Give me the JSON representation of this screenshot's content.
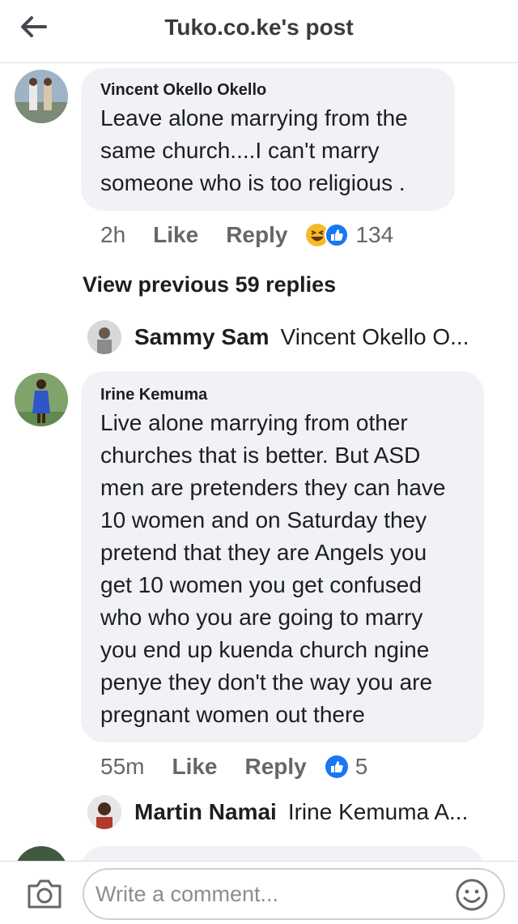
{
  "header": {
    "title": "Tuko.co.ke's post",
    "back_icon": "arrow-left-icon"
  },
  "comments": [
    {
      "author": "Vincent Okello Okello",
      "lines": [
        "Leave alone marrying from  the",
        "same church....I can't marry",
        "someone who is too religious ."
      ],
      "time": "2h",
      "like_label": "Like",
      "reply_label": "Reply",
      "reactions": [
        "haha-icon",
        "like-icon"
      ],
      "reaction_count": "134"
    },
    {
      "author": "Irine Kemuma",
      "lines": [
        "Live alone marrying from other",
        "churches that is better. But ASD",
        "men are pretenders they can have",
        "10 women and on Saturday they",
        "pretend that they are Angels you",
        "get 10 women you get confused",
        "who who you are going to marry",
        "you end up kuenda  church ngine",
        "penye they don't  the way you are",
        "pregnant women out there"
      ],
      "time": "55m",
      "like_label": "Like",
      "reply_label": "Reply",
      "reactions": [
        "like-icon"
      ],
      "reaction_count": "5"
    }
  ],
  "view_previous": "View previous 59 replies",
  "replies": [
    {
      "name": "Sammy Sam",
      "preview": "Vincent Okello O..."
    },
    {
      "name": "Martin Namai",
      "preview": "Irine Kemuma A..."
    }
  ],
  "composer": {
    "placeholder": "Write a comment...",
    "camera_icon": "camera-icon",
    "emoji_icon": "emoji-icon"
  },
  "colors": {
    "like_blue": "#1877f2",
    "haha_yellow": "#f7b928",
    "bubble_bg": "#f0f2f5",
    "meta_gray": "#65676b"
  }
}
